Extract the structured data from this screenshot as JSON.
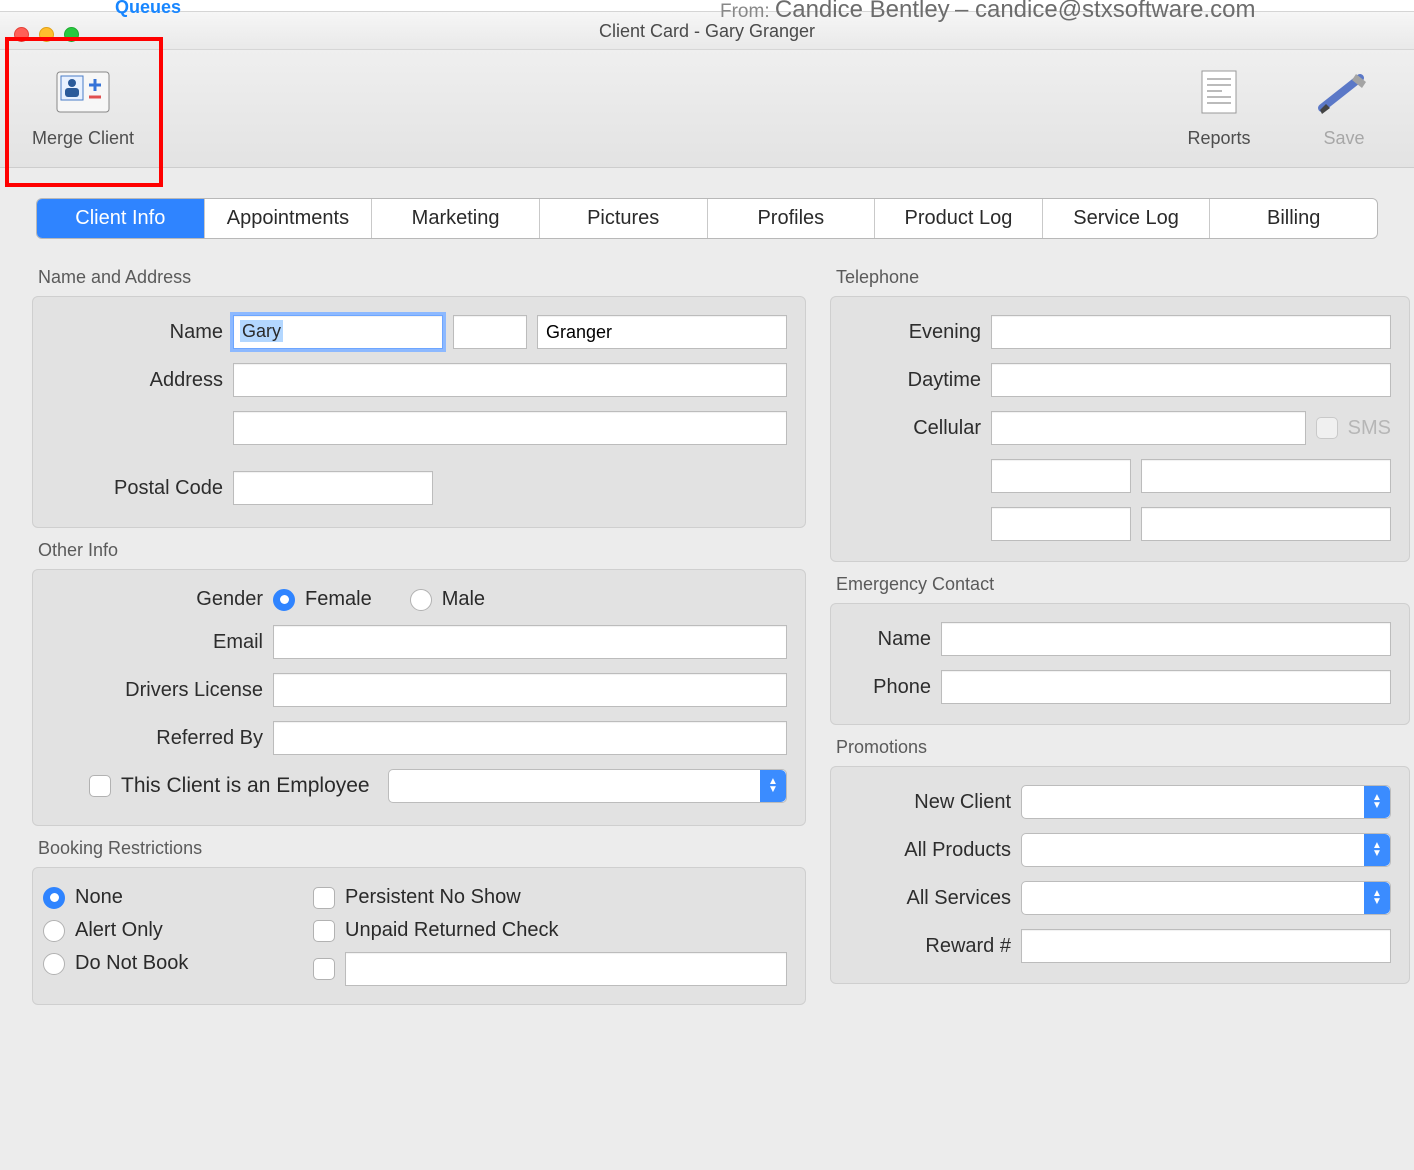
{
  "topstrip": {
    "queues": "Queues",
    "from_label": "From:",
    "from_name": "Candice Bentley",
    "from_email": "candice@stxsoftware.com"
  },
  "window_title": "Client Card - Gary Granger",
  "toolbar": {
    "merge": "Merge Client",
    "reports": "Reports",
    "save": "Save"
  },
  "tabs": [
    "Client Info",
    "Appointments",
    "Marketing",
    "Pictures",
    "Profiles",
    "Product Log",
    "Service Log",
    "Billing"
  ],
  "name_address": {
    "title": "Name and Address",
    "name_label": "Name",
    "first": "Gary",
    "middle": "",
    "last": "Granger",
    "address_label": "Address",
    "address1": "",
    "address2": "",
    "postal_label": "Postal Code",
    "postal": ""
  },
  "other_info": {
    "title": "Other Info",
    "gender_label": "Gender",
    "female": "Female",
    "male": "Male",
    "email_label": "Email",
    "license_label": "Drivers License",
    "referred_label": "Referred By",
    "employee_label": "This Client is an Employee"
  },
  "booking": {
    "title": "Booking Restrictions",
    "none": "None",
    "alert": "Alert Only",
    "donot": "Do Not Book",
    "persistent": "Persistent No Show",
    "unpaid": "Unpaid Returned Check"
  },
  "telephone": {
    "title": "Telephone",
    "evening": "Evening",
    "daytime": "Daytime",
    "cellular": "Cellular",
    "sms": "SMS"
  },
  "emergency": {
    "title": "Emergency Contact",
    "name": "Name",
    "phone": "Phone"
  },
  "promotions": {
    "title": "Promotions",
    "new_client": "New Client",
    "all_products": "All Products",
    "all_services": "All Services",
    "reward": "Reward #"
  }
}
